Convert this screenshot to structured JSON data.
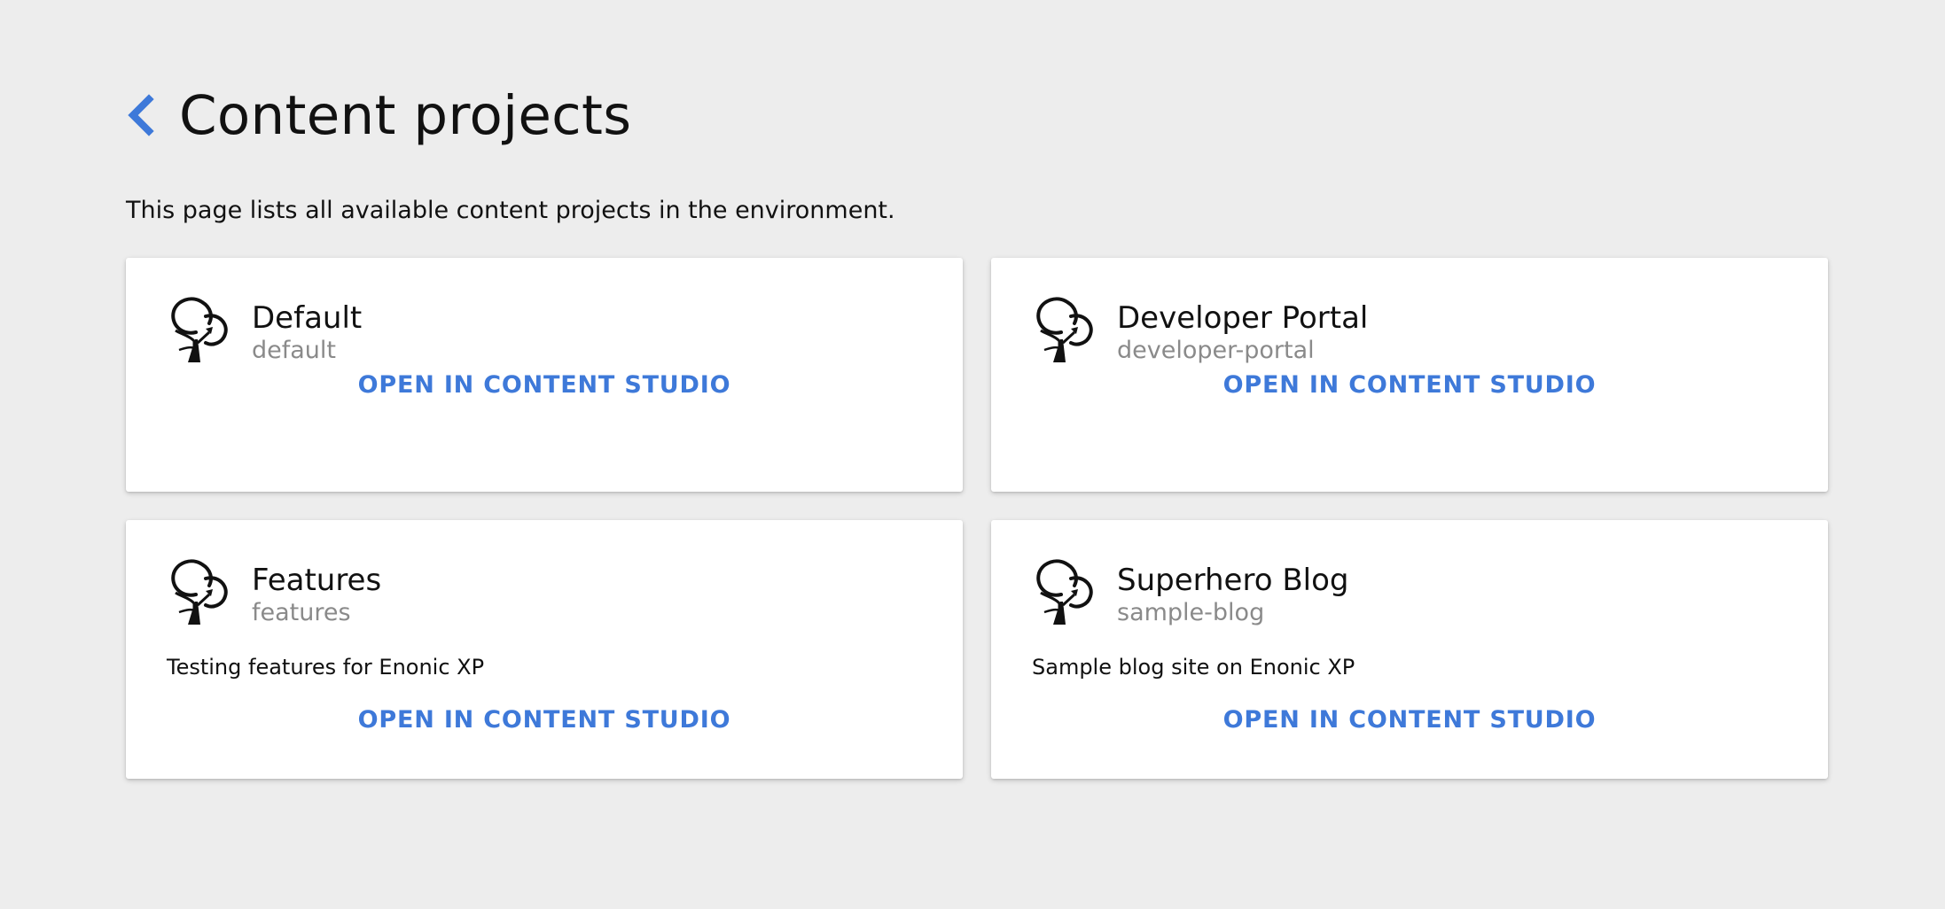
{
  "header": {
    "back_icon": "chevron-left-icon",
    "title": "Content projects"
  },
  "description": "This page lists all available content projects in the environment.",
  "colors": {
    "background": "#ededed",
    "card": "#ffffff",
    "accent": "#3e79d9",
    "muted_text": "#8a8a8a"
  },
  "projects": [
    {
      "name": "Default",
      "id": "default",
      "description": "",
      "icon": "tree-icon",
      "link_label": "OPEN IN CONTENT STUDIO"
    },
    {
      "name": "Developer Portal",
      "id": "developer-portal",
      "description": "",
      "icon": "tree-icon",
      "link_label": "OPEN IN CONTENT STUDIO"
    },
    {
      "name": "Features",
      "id": "features",
      "description": "Testing features for Enonic XP",
      "icon": "tree-icon",
      "link_label": "OPEN IN CONTENT STUDIO"
    },
    {
      "name": "Superhero Blog",
      "id": "sample-blog",
      "description": "Sample blog site on Enonic XP",
      "icon": "tree-icon",
      "link_label": "OPEN IN CONTENT STUDIO"
    }
  ]
}
